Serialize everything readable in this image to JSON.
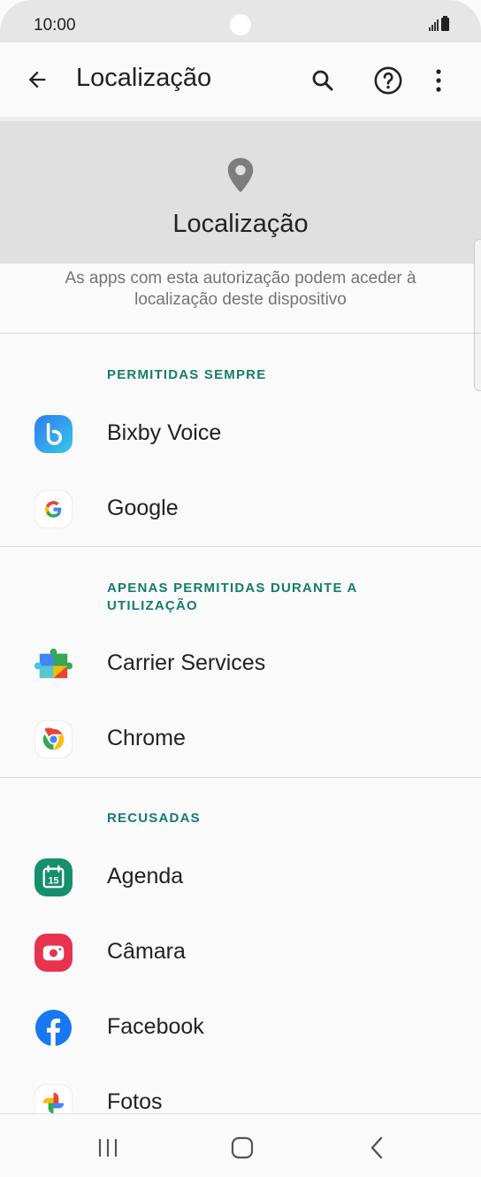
{
  "status_bar": {
    "time": "10:00"
  },
  "app_bar": {
    "title": "Localização"
  },
  "header": {
    "title": "Localização",
    "description": "As apps com esta autorização podem aceder à localização deste dispositivo"
  },
  "sections": [
    {
      "label": "PERMITIDAS SEMPRE",
      "apps": [
        "Bixby Voice",
        "Google"
      ]
    },
    {
      "label": "APENAS PERMITIDAS DURANTE A UTILIZAÇÃO",
      "apps": [
        "Carrier Services",
        "Chrome"
      ]
    },
    {
      "label": "RECUSADAS",
      "apps": [
        "Agenda",
        "Câmara",
        "Facebook",
        "Fotos"
      ]
    }
  ],
  "icons": {
    "back": "arrow-left-icon",
    "search": "search-icon",
    "help": "help-circle-icon",
    "more": "more-vert-icon",
    "pin": "location-pin-icon",
    "agenda_day": "15"
  },
  "colors": {
    "accent": "#147d6c",
    "header_bg": "#e0e0e0",
    "background": "#fafafa"
  }
}
